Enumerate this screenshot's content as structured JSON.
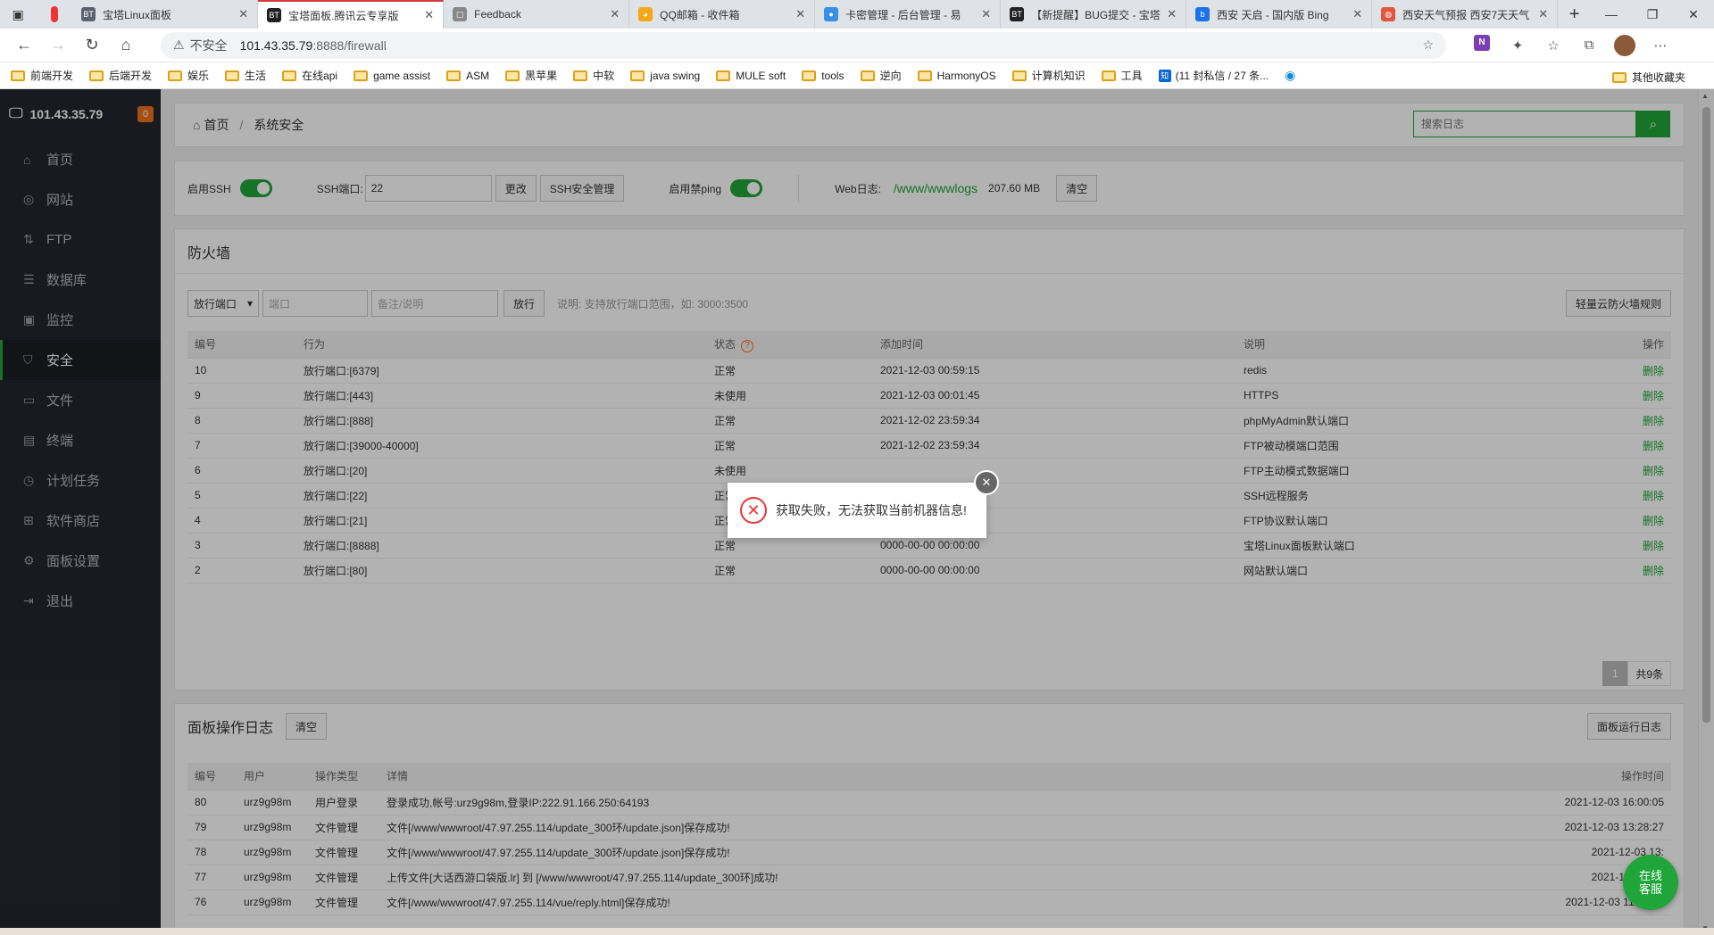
{
  "browser": {
    "tabs": [
      {
        "title": "宝塔Linux面板",
        "fav": "BT",
        "color": "#5a6270",
        "active": false
      },
      {
        "title": "宝塔面板.腾讯云专享版",
        "fav": "BT",
        "color": "#222",
        "active": true
      },
      {
        "title": "Feedback",
        "fav": "▢",
        "color": "#888",
        "active": false
      },
      {
        "title": "QQ邮箱 - 收件箱",
        "fav": "◕",
        "color": "#f3a81a",
        "active": false
      },
      {
        "title": "卡密管理 - 后台管理 - 易",
        "fav": "●",
        "color": "#3a8ee6",
        "active": false
      },
      {
        "title": "【新提醒】BUG提交 - 宝塔",
        "fav": "BT",
        "color": "#222",
        "active": false
      },
      {
        "title": "西安 天启 - 国内版 Bing",
        "fav": "b",
        "color": "#1a73e8",
        "active": false
      },
      {
        "title": "西安天气预报 西安7天天气",
        "fav": "◍",
        "color": "#e0573e",
        "active": false
      }
    ],
    "address": {
      "security": "不安全",
      "host": "101.43.35.79",
      "path": ":8888/firewall"
    },
    "bookmarks": [
      "前端开发",
      "后端开发",
      "娱乐",
      "生活",
      "在线api",
      "game assist",
      "ASM",
      "黑苹果",
      "中软",
      "java swing",
      "MULE soft",
      "tools",
      "逆向",
      "HarmonyOS",
      "计算机知识",
      "工具"
    ],
    "bookmark_zhihu": "(11 封私信 / 27 条...",
    "bookmark_other": "其他收藏夹"
  },
  "sidebar": {
    "host": "101.43.35.79",
    "badge": "0",
    "items": [
      {
        "label": "首页",
        "icon": "⌂"
      },
      {
        "label": "网站",
        "icon": "◎"
      },
      {
        "label": "FTP",
        "icon": "⇅"
      },
      {
        "label": "数据库",
        "icon": "☰"
      },
      {
        "label": "监控",
        "icon": "▣"
      },
      {
        "label": "安全",
        "icon": "⛉",
        "active": true
      },
      {
        "label": "文件",
        "icon": "▭"
      },
      {
        "label": "终端",
        "icon": "▤"
      },
      {
        "label": "计划任务",
        "icon": "◷"
      },
      {
        "label": "软件商店",
        "icon": "⊞"
      },
      {
        "label": "面板设置",
        "icon": "⚙"
      },
      {
        "label": "退出",
        "icon": "⇥"
      }
    ]
  },
  "crumb": {
    "home": "首页",
    "current": "系统安全",
    "search_placeholder": "搜索日志"
  },
  "settings": {
    "ssh_label": "启用SSH",
    "port_label": "SSH端口:",
    "port_value": "22",
    "change_btn": "更改",
    "ssh_manage_btn": "SSH安全管理",
    "ping_label": "启用禁ping",
    "weblog_label": "Web日志:",
    "weblog_path": "/www/wwwlogs",
    "weblog_size": "207.60 MB",
    "clear_btn": "清空"
  },
  "firewall": {
    "title": "防火墙",
    "type_select": "放行端口",
    "port_placeholder": "端口",
    "remark_placeholder": "备注/说明",
    "allow_btn": "放行",
    "hint": "说明: 支持放行端口范围，如: 3000:3500",
    "cloud_btn": "轻量云防火墙规则",
    "headers": [
      "编号",
      "行为",
      "状态",
      "添加时间",
      "说明",
      "操作"
    ],
    "rows": [
      [
        "10",
        "放行端口:[6379]",
        "正常",
        "2021-12-03 00:59:15",
        "redis",
        "删除"
      ],
      [
        "9",
        "放行端口:[443]",
        "未使用",
        "2021-12-03 00:01:45",
        "HTTPS",
        "删除"
      ],
      [
        "8",
        "放行端口:[888]",
        "正常",
        "2021-12-02 23:59:34",
        "phpMyAdmin默认端口",
        "删除"
      ],
      [
        "7",
        "放行端口:[39000-40000]",
        "正常",
        "2021-12-02 23:59:34",
        "FTP被动模端口范围",
        "删除"
      ],
      [
        "6",
        "放行端口:[20]",
        "未使用",
        "",
        "FTP主动模式数据端口",
        "删除"
      ],
      [
        "5",
        "放行端口:[22]",
        "正常",
        "",
        "SSH远程服务",
        "删除"
      ],
      [
        "4",
        "放行端口:[21]",
        "正常",
        "0000-00-00 00:00:00",
        "FTP协议默认端口",
        "删除"
      ],
      [
        "3",
        "放行端口:[8888]",
        "正常",
        "0000-00-00 00:00:00",
        "宝塔Linux面板默认端口",
        "删除"
      ],
      [
        "2",
        "放行端口:[80]",
        "正常",
        "0000-00-00 00:00:00",
        "网站默认端口",
        "删除"
      ]
    ],
    "page": "1",
    "total": "共9条"
  },
  "logs": {
    "title": "面板操作日志",
    "clear_btn": "清空",
    "run_log_btn": "面板运行日志",
    "headers": [
      "编号",
      "用户",
      "操作类型",
      "详情",
      "操作时间"
    ],
    "rows": [
      [
        "80",
        "urz9g98m",
        "用户登录",
        "登录成功,帐号:urz9g98m,登录IP:222.91.166.250:64193",
        "2021-12-03 16:00:05"
      ],
      [
        "79",
        "urz9g98m",
        "文件管理",
        "文件[/www/wwwroot/47.97.255.114/update_300环/update.json]保存成功!",
        "2021-12-03 13:28:27"
      ],
      [
        "78",
        "urz9g98m",
        "文件管理",
        "文件[/www/wwwroot/47.97.255.114/update_300环/update.json]保存成功!",
        "2021-12-03 13:"
      ],
      [
        "77",
        "urz9g98m",
        "文件管理",
        "上传文件[大话西游口袋版.lr] 到 [/www/wwwroot/47.97.255.114/update_300环]成功!",
        "2021-12-03 13:"
      ],
      [
        "76",
        "urz9g98m",
        "文件管理",
        "文件[/www/wwwroot/47.97.255.114/vue/reply.html]保存成功!",
        "2021-12-03 11:20:20"
      ]
    ]
  },
  "toast": {
    "message": "获取失败，无法获取当前机器信息!"
  },
  "service": {
    "line1": "在线",
    "line2": "客服"
  }
}
